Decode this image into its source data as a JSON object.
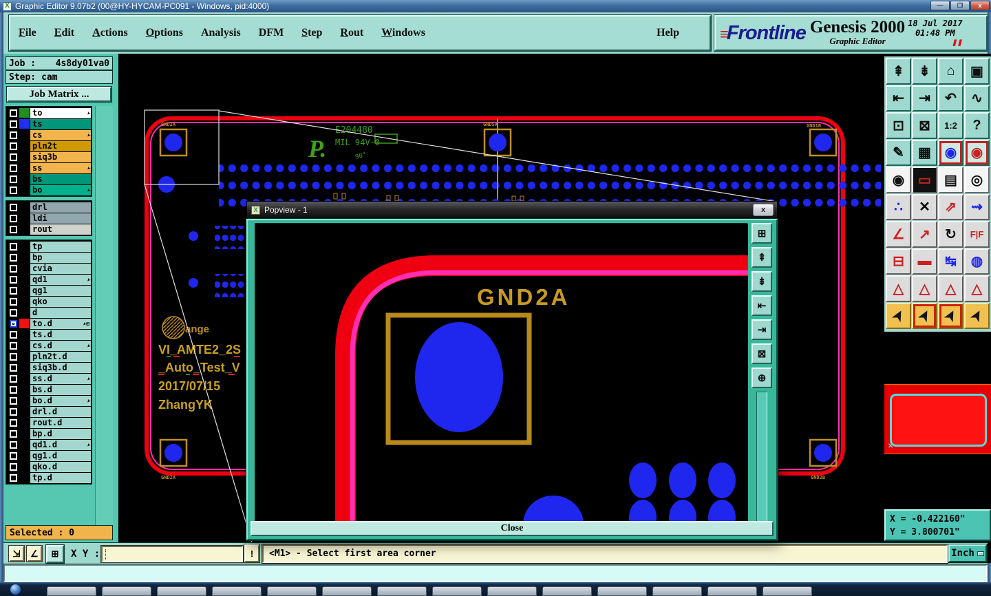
{
  "window": {
    "title": "Graphic Editor 9.07b2 (00@HY-HYCAM-PC091 - Windows, pid:4000)",
    "icon_glyph": "X",
    "minimize": "—",
    "maximize": "❐",
    "close": "x"
  },
  "menubar": {
    "items": [
      {
        "label": "File",
        "accel": true
      },
      {
        "label": "Edit",
        "accel": true
      },
      {
        "label": "Actions",
        "accel": true
      },
      {
        "label": "Options",
        "accel": true
      },
      {
        "label": "Analysis",
        "accel": false
      },
      {
        "label": "DFM",
        "accel": false
      },
      {
        "label": "Step",
        "accel": true
      },
      {
        "label": "Rout",
        "accel": true
      },
      {
        "label": "Windows",
        "accel": true
      }
    ],
    "help": "Help"
  },
  "brand": {
    "stripes": "≡",
    "logo": "Frontline",
    "product": "Genesis 2000",
    "subtitle": "Graphic Editor",
    "date": "18 Jul 2017",
    "time": "01:48 PM",
    "pause": "❚❚"
  },
  "sidebar": {
    "job_label": "Job :",
    "job_value": "4s8dy01va0",
    "step_label": "Step:",
    "step_value": "cam",
    "job_matrix": "Job Matrix ...",
    "selected": "Selected : 0",
    "arrow_glyph": "➤",
    "layer_groups": [
      [
        {
          "name": "to",
          "bg": "#ffffff",
          "swatch": "#1f8f1f",
          "arrow": true
        },
        {
          "name": "ts",
          "bg": "#00967a",
          "swatch": "#2030ee",
          "arrow": false
        },
        {
          "name": "cs",
          "bg": "#f2b54e",
          "swatch": "",
          "arrow": true
        },
        {
          "name": "pln2t",
          "bg": "#cf9a00",
          "swatch": "",
          "arrow": false
        },
        {
          "name": "siq3b",
          "bg": "#f2b54e",
          "swatch": "",
          "arrow": false
        },
        {
          "name": "ss",
          "bg": "#f2b54e",
          "swatch": "",
          "arrow": true
        },
        {
          "name": "bs",
          "bg": "#00967a",
          "swatch": "",
          "arrow": false
        },
        {
          "name": "bo",
          "bg": "#00b08a",
          "swatch": "",
          "arrow": true
        }
      ],
      [
        {
          "name": "drl",
          "bg": "#91a6ad",
          "swatch": "",
          "arrow": false
        },
        {
          "name": "ldi",
          "bg": "#91a6ad",
          "swatch": "",
          "arrow": false
        },
        {
          "name": "rout",
          "bg": "#cdd2cd",
          "swatch": "",
          "arrow": false
        }
      ],
      [
        {
          "name": "tp",
          "bg": "#a3d6ce",
          "swatch": "",
          "arrow": false
        },
        {
          "name": "bp",
          "bg": "#a3d6ce",
          "swatch": "",
          "arrow": false
        },
        {
          "name": "cvia",
          "bg": "#a3d6ce",
          "swatch": "",
          "arrow": false
        },
        {
          "name": "qd1",
          "bg": "#a3d6ce",
          "swatch": "",
          "arrow": true
        },
        {
          "name": "qg1",
          "bg": "#a3d6ce",
          "swatch": "",
          "arrow": false
        },
        {
          "name": "qko",
          "bg": "#a3d6ce",
          "swatch": "",
          "arrow": false
        },
        {
          "name": "d",
          "bg": "#a3d6ce",
          "swatch": "",
          "arrow": false
        },
        {
          "name": "to.d",
          "bg": "#a3d6ce",
          "swatch": "#ee1111",
          "arrow": true,
          "selected": true,
          "extra": "⊞"
        },
        {
          "name": "ts.d",
          "bg": "#a3d6ce",
          "swatch": "",
          "arrow": false
        },
        {
          "name": "cs.d",
          "bg": "#a3d6ce",
          "swatch": "",
          "arrow": true
        },
        {
          "name": "pln2t.d",
          "bg": "#a3d6ce",
          "swatch": "",
          "arrow": false
        },
        {
          "name": "siq3b.d",
          "bg": "#a3d6ce",
          "swatch": "",
          "arrow": false
        },
        {
          "name": "ss.d",
          "bg": "#a3d6ce",
          "swatch": "",
          "arrow": true
        },
        {
          "name": "bs.d",
          "bg": "#a3d6ce",
          "swatch": "",
          "arrow": false
        },
        {
          "name": "bo.d",
          "bg": "#a3d6ce",
          "swatch": "",
          "arrow": true
        },
        {
          "name": "drl.d",
          "bg": "#a3d6ce",
          "swatch": "",
          "arrow": false
        },
        {
          "name": "rout.d",
          "bg": "#a3d6ce",
          "swatch": "",
          "arrow": false
        },
        {
          "name": "bp.d",
          "bg": "#a3d6ce",
          "swatch": "",
          "arrow": false
        },
        {
          "name": "qd1.d",
          "bg": "#a3d6ce",
          "swatch": "",
          "arrow": true
        },
        {
          "name": "qg1.d",
          "bg": "#a3d6ce",
          "swatch": "",
          "arrow": false
        },
        {
          "name": "qko.d",
          "bg": "#a3d6ce",
          "swatch": "",
          "arrow": false
        },
        {
          "name": "tp.d",
          "bg": "#a3d6ce",
          "swatch": "",
          "arrow": false
        }
      ]
    ]
  },
  "toolbar_right": {
    "buttons": [
      {
        "name": "zoom-in-view",
        "glyph": "⇞",
        "style": "teal"
      },
      {
        "name": "zoom-out-view",
        "glyph": "⇟",
        "style": "teal"
      },
      {
        "name": "home-view",
        "glyph": "⌂",
        "style": "teal"
      },
      {
        "name": "tile-windows-xy",
        "glyph": "▣",
        "style": "teal"
      },
      {
        "name": "pan-left",
        "glyph": "⇤",
        "style": "teal"
      },
      {
        "name": "pan-right",
        "glyph": "⇥",
        "style": "teal"
      },
      {
        "name": "previous-view",
        "glyph": "↶",
        "style": "teal"
      },
      {
        "name": "serpentine-route",
        "glyph": "∿",
        "style": "teal"
      },
      {
        "name": "zoom-fit",
        "glyph": "⊡",
        "style": "teal"
      },
      {
        "name": "zoom-extents",
        "glyph": "⊠",
        "style": "teal"
      },
      {
        "name": "scale-1-2",
        "glyph": "1:2",
        "style": "teal",
        "gcls": "small"
      },
      {
        "name": "help-context",
        "glyph": "?",
        "style": "teal"
      },
      {
        "name": "setup-tools",
        "glyph": "✎",
        "style": "teal"
      },
      {
        "name": "grid-setup",
        "glyph": "▦",
        "style": "teal"
      },
      {
        "name": "netlist-cross-probe",
        "glyph": "◉",
        "style": "rednet",
        "gcls": "blue"
      },
      {
        "name": "netlist-compare",
        "glyph": "◉",
        "style": "rednet",
        "gcls": "red"
      },
      {
        "name": "feature-info",
        "glyph": "◉",
        "style": "white"
      },
      {
        "name": "polygon-edit",
        "glyph": "▭",
        "style": "dark",
        "gcls": "red"
      },
      {
        "name": "measure-ruler",
        "glyph": "▤",
        "style": "white"
      },
      {
        "name": "pad-select",
        "glyph": "◎",
        "style": "white"
      },
      {
        "name": "connect-net-points",
        "glyph": "∴",
        "style": "gray",
        "gcls": "blue"
      },
      {
        "name": "delete-feature",
        "glyph": "✕",
        "style": "gray"
      },
      {
        "name": "copy-feature",
        "glyph": "⇗",
        "style": "gray",
        "gcls": "red"
      },
      {
        "name": "move-feature",
        "glyph": "⇝",
        "style": "gray",
        "gcls": "blue"
      },
      {
        "name": "measure-angle",
        "glyph": "∠",
        "style": "gray",
        "gcls": "red"
      },
      {
        "name": "add-line",
        "glyph": "↗",
        "style": "gray",
        "gcls": "red"
      },
      {
        "name": "rotate-feature",
        "glyph": "↻",
        "style": "gray"
      },
      {
        "name": "mirror-feature",
        "glyph": "F|F",
        "style": "gray",
        "gcls": "small red"
      },
      {
        "name": "swap-pad",
        "glyph": "⊟",
        "style": "gray",
        "gcls": "red"
      },
      {
        "name": "break-line",
        "glyph": "▬",
        "style": "gray",
        "gcls": "red"
      },
      {
        "name": "measure-pitch",
        "glyph": "↹",
        "style": "gray",
        "gcls": "blue"
      },
      {
        "name": "surface-edit",
        "glyph": "◍",
        "style": "gray",
        "gcls": "blue"
      },
      {
        "name": "apex-marker-a",
        "glyph": "△",
        "style": "gray",
        "gcls": "red"
      },
      {
        "name": "apex-marker-b",
        "glyph": "△",
        "style": "gray",
        "gcls": "red"
      },
      {
        "name": "apex-marker-c",
        "glyph": "△",
        "style": "gray",
        "gcls": "red"
      },
      {
        "name": "apex-marker-d",
        "glyph": "△",
        "style": "gray",
        "gcls": "red"
      },
      {
        "name": "select-cursor",
        "glyph": "➤",
        "style": "orange",
        "gcls": "rot"
      },
      {
        "name": "select-inside-frame",
        "glyph": "➤",
        "style": "orange redin",
        "gcls": "rot"
      },
      {
        "name": "select-inside-polygon",
        "glyph": "➤",
        "style": "orange redin",
        "gcls": "rot"
      },
      {
        "name": "select-net-cursor",
        "glyph": "➤",
        "style": "orange",
        "gcls": "rot"
      }
    ]
  },
  "coords": {
    "x_line": "X = -0.422160\"",
    "y_line": "Y = 3.800701\""
  },
  "bottombar": {
    "resize_icon": "⇲",
    "angle_icon": "∠",
    "grid_icon": "⊞",
    "xy_label": "X Y :",
    "input_value": "",
    "alert": "!",
    "status": "<M1> - Select first area corner",
    "units": "Inch"
  },
  "canvas": {
    "pad_labels": {
      "tl": "GND2A",
      "tm": "GND5A",
      "tr": "GND1B",
      "bl": "GND2A",
      "br": "GND2B"
    },
    "silkscreen": {
      "logo": "P.",
      "ul_number": "E204480",
      "flam": "MIL 94V-0",
      "angle": "90°"
    },
    "annotation": {
      "ring_text": "ange",
      "line1": "VI_AMTE2_2S",
      "line2": "_Auto_Test_V",
      "line3": "2017/07/15",
      "line4": "ZhangYK"
    },
    "colors": {
      "board_red": "#ee0011",
      "trace_pink": "#ff2fb4",
      "pad_blue": "#1f27ee",
      "gold": "#bf8f20",
      "silk_green": "#3fa01c"
    }
  },
  "popview": {
    "title": "Popview - 1",
    "close_x": "x",
    "net_label": "GND2A",
    "close_button": "Close",
    "side_buttons": [
      {
        "name": "popview-new-window",
        "glyph": "⊞"
      },
      {
        "name": "popview-zoom-in",
        "glyph": "⇞"
      },
      {
        "name": "popview-zoom-out",
        "glyph": "⇟"
      },
      {
        "name": "popview-pan-left",
        "glyph": "⇤"
      },
      {
        "name": "popview-pan-right",
        "glyph": "⇥"
      },
      {
        "name": "popview-zoom-fit",
        "glyph": "⊠"
      },
      {
        "name": "popview-center-view",
        "glyph": "⊕"
      }
    ]
  },
  "taskbar": {
    "button_count": 14
  }
}
